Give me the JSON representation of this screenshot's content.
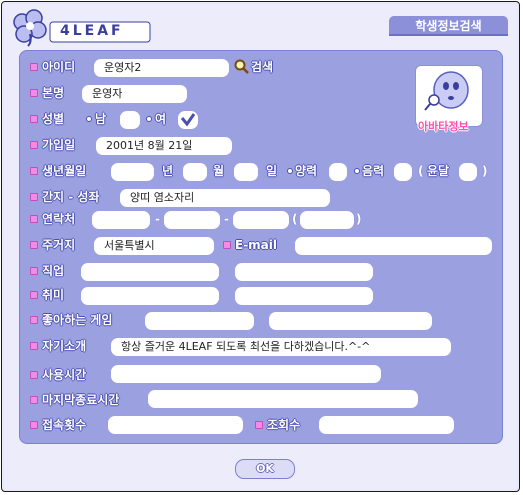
{
  "window": {
    "title": "학생정보검색",
    "logo_text": "4LEAF"
  },
  "fields": {
    "id": {
      "label": "아이디",
      "value": "운영자2"
    },
    "search_button": "검색",
    "real_name": {
      "label": "본명",
      "value": "운영자"
    },
    "gender": {
      "label": "성별",
      "male": "남",
      "female": "여",
      "selected": "여"
    },
    "join_date": {
      "label": "가입일",
      "value": "2001년 8월 21일"
    },
    "birthday": {
      "label": "생년월일",
      "year_unit": "년",
      "month_unit": "월",
      "day_unit": "일",
      "solar": "양력",
      "lunar": "음력",
      "leap_open": "(",
      "leap": "윤달",
      "leap_close": ")"
    },
    "zodiac": {
      "label": "간지 - 성좌",
      "value": "양띠 염소자리"
    },
    "contact": {
      "label": "연락처",
      "dash": "-",
      "paren_open": "(",
      "paren_close": ")"
    },
    "address": {
      "label": "주거지",
      "value": "서울특별시"
    },
    "email": {
      "label": "E-mail",
      "value": ""
    },
    "job": {
      "label": "직업"
    },
    "hobby": {
      "label": "취미"
    },
    "favorite_game": {
      "label": "좋아하는 게임"
    },
    "intro": {
      "label": "자기소개",
      "value": "항상 즐거운 4LEAF 되도록 최선을 다하겠습니다.^-^"
    },
    "usage_time": {
      "label": "사용시간"
    },
    "last_login": {
      "label": "마지막종료시간"
    },
    "login_count": {
      "label": "접속횟수"
    },
    "view_count": {
      "label": "조회수"
    }
  },
  "avatar": {
    "label": "아바타정보",
    "icon": "ghost-avatar-icon"
  },
  "ok_button": "OK",
  "colors": {
    "panel": "#9aa0e0",
    "tab": "#8b90d8",
    "bullet": "#f08be6",
    "background": "#e9e9fb"
  }
}
